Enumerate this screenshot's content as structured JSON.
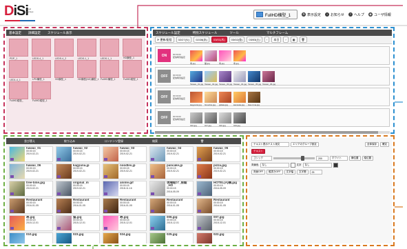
{
  "header": {
    "logo_text": "DiSi",
    "logo_sub": "cloud signage",
    "screen_select": "FullHD横型_1",
    "nav": [
      {
        "icon": "display-settings-icon",
        "label": "表示設定"
      },
      {
        "icon": "info-icon",
        "label": "お知らせ"
      },
      {
        "icon": "help-icon",
        "label": "ヘルプ"
      },
      {
        "icon": "user-icon",
        "label": "ユーザ情報"
      }
    ]
  },
  "colors": {
    "pink": "#c5305a",
    "blue": "#2b8fd0",
    "green": "#6cae44",
    "orange": "#d9791f",
    "accent_red": "#d61f3c"
  },
  "frames_panel": {
    "tabs": [
      "基本設定",
      "詳細設定",
      "スケジュール表示"
    ],
    "frames": [
      "PDP_1",
      "LEDS-4_1",
      "LEDS-4_2",
      "LEDS-1_1",
      "LEDS-1_1",
      "HD横型_1",
      "LED1-4_1",
      "LPD横型_1",
      "HD横型_1",
      "HD横型(NG)横型_1",
      "FullHD横型_1",
      "FullHD縦型_1",
      "FullHD縦型_",
      "FullHD縦型_1"
    ]
  },
  "schedule_panel": {
    "tabs": [
      "スケジュール設定",
      "特別スケジュール",
      "ツール",
      "マルチフレーム"
    ],
    "toolbar": [
      "更新/配信",
      "02/27(火)",
      "02/28(水)",
      "03/01(木)",
      "03/02(金)",
      "03/03(土)",
      "本日"
    ],
    "rows": [
      {
        "status": "ON",
        "time_from": "00:00:00",
        "time_label": "配信時刻設定",
        "items": [
          "寿.jpg",
          "猫.jpg",
          "寿.jpg",
          "寿.jpg"
        ]
      },
      {
        "status": "OFF",
        "time_from": "00:00:00",
        "time_label": "配信時刻設定",
        "items": [
          "Taiwan_01.jpg",
          "Taiwan_02.jpg",
          "Taiwan_03.jpg",
          "Taiwan_04.jpg",
          "Taiwan_05.jpg",
          "Taiwan_06.jpg"
        ]
      },
      {
        "status": "OFF",
        "time_from": "00:00:00",
        "time_label": "配信時刻設定",
        "items": [
          "kagyuzai.jpg",
          "hinoshio.jpg",
          "gldata.jpg",
          "kamioka.jpg",
          "Ikai-nima.jpg"
        ]
      },
      {
        "status": "OFF",
        "time_from": "00:00:00",
        "time_label": "配信時刻設定",
        "items": [
          "016.jpg",
          "017.jpg",
          "016.jpg",
          "019.jpg"
        ]
      }
    ]
  },
  "content_panel": {
    "tabs": [
      "並び替え",
      "絞り込み",
      "コンテンツ登録",
      "検索"
    ],
    "items": [
      {
        "name": "hawaii_01",
        "dur": "00:00:15",
        "date": "2019-02-21"
      },
      {
        "name": "hawaii_02",
        "dur": "00:00:15",
        "date": "2019-02-21"
      },
      {
        "name": "hawaii_03",
        "dur": "00:00:15",
        "date": "2019-02-21"
      },
      {
        "name": "hawaii_04",
        "dur": "00:00:15",
        "date": "2019-02-21"
      },
      {
        "name": "hawaii_05",
        "dur": "00:00:15",
        "date": "2019-02-21"
      },
      {
        "name": "hawaii_06",
        "dur": "00:00:15",
        "date": "2019-02-21"
      },
      {
        "name": "kagyuna.jp",
        "dur": "00:00:15",
        "date": "2019-02-21"
      },
      {
        "name": "noodles.jp",
        "dur": "00:00:15",
        "date": "2019-02-21"
      },
      {
        "name": "pancake.jp",
        "dur": "00:00:15",
        "date": "2019-02-21"
      },
      {
        "name": "pizza.jpg",
        "dur": "00:00:15",
        "date": "2019-02-21"
      },
      {
        "name": "tree-time.jpg",
        "dur": "00:00:15",
        "date": "2019-02-21"
      },
      {
        "name": "original_m",
        "dur": "00:00:15",
        "date": "2019-02-21"
      },
      {
        "name": "anime.gif",
        "dur": "00:00:15",
        "date": "2018-11-16"
      },
      {
        "name": "現場紹介_房総_HO",
        "dur": "00:00:15",
        "date": "2016-05-09"
      },
      {
        "name": "HOTEL(A)横.jpg",
        "dur": "00:00:15",
        "date": "2016-05-09"
      },
      {
        "name": "Restaurant",
        "dur": "00:00:15",
        "date": "2016-01-05"
      },
      {
        "name": "Restaurant",
        "dur": "00:00:15",
        "date": "2016-01-05"
      },
      {
        "name": "Restaurant",
        "dur": "00:00:15",
        "date": "2016-01-05"
      },
      {
        "name": "Restaurant",
        "dur": "00:00:15",
        "date": "2016-01-05"
      },
      {
        "name": "Restaurant",
        "dur": "00:00:15",
        "date": "2016-01-05"
      },
      {
        "name": "寿.jpg",
        "dur": "00:00:15",
        "date": "2015-12-01"
      },
      {
        "name": "猫.jpg",
        "dur": "00:00:15",
        "date": "2015-12-01"
      },
      {
        "name": "寿.jpg",
        "dur": "00:00:15",
        "date": "2015-12-01"
      },
      {
        "name": "006.jpg",
        "dur": "00:00:15",
        "date": "2015-12-01"
      },
      {
        "name": "007.jpg",
        "dur": "00:00:15",
        "date": "2015-12-01"
      },
      {
        "name": "010.jpg",
        "dur": "",
        "date": ""
      },
      {
        "name": "023.jpg",
        "dur": "",
        "date": ""
      },
      {
        "name": "024.jpg",
        "dur": "",
        "date": ""
      },
      {
        "name": "025.jpg",
        "dur": "",
        "date": ""
      },
      {
        "name": "022.jpg",
        "dur": "",
        "date": ""
      }
    ]
  },
  "editor_panel": {
    "title": "テキスト表示テスト用文",
    "group_label": "エリアのグループ設定",
    "btn_save": "全体保存",
    "btn_ok": "確定",
    "btn_text": "テキスト",
    "font_label": "ゴシック",
    "size_value": "200",
    "color_label": "ホワイト",
    "btn_bold": "横位置",
    "btn_italic": "縦位置",
    "bg_label": "背景色",
    "bg_value": "なし",
    "align_label": "文字",
    "align_value": "なし",
    "opts": [
      "背景OFF",
      "縦書きOFF",
      "文字幅",
      "文字間"
    ],
    "count": "25"
  }
}
